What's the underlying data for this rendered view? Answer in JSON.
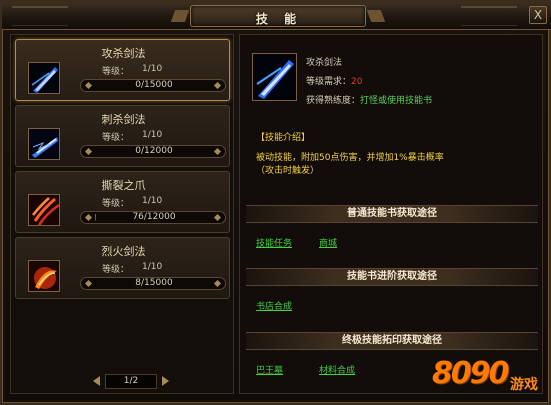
{
  "window": {
    "title": "技 能",
    "close_label": "X"
  },
  "skills": [
    {
      "name": "攻杀剑法",
      "level_label": "等级：",
      "level": "1/10",
      "exp": "0/15000",
      "exp_fraction": 0.0,
      "selected": true
    },
    {
      "name": "刺杀剑法",
      "level_label": "等级：",
      "level": "1/10",
      "exp": "0/12000",
      "exp_fraction": 0.0,
      "selected": false
    },
    {
      "name": "撕裂之爪",
      "level_label": "等级：",
      "level": "1/10",
      "exp": "76/12000",
      "exp_fraction": 0.006,
      "selected": false
    },
    {
      "name": "烈火剑法",
      "level_label": "等级：",
      "level": "1/10",
      "exp": "8/15000",
      "exp_fraction": 0.0005,
      "selected": false
    }
  ],
  "pager": {
    "text": "1/2"
  },
  "detail": {
    "name": "攻杀剑法",
    "level_req_label": "等级需求：",
    "level_req_value": "20",
    "proficiency_label": "获得熟练度：",
    "proficiency_value": "打怪或使用技能书",
    "intro_heading": "【技能介绍】",
    "intro_text": "被动技能，附加50点伤害，并增加1%暴击概率（攻击时触发）"
  },
  "sections": {
    "normal": {
      "title": "普通技能书获取途径",
      "links": [
        "技能任务",
        "商城"
      ]
    },
    "advanced": {
      "title": "技能书进阶获取途径",
      "links": [
        "书店合成"
      ]
    },
    "ultimate": {
      "title": "终极技能拓印获取途径",
      "links": [
        "巴王墓",
        "材料合成"
      ]
    }
  },
  "watermark": {
    "text": "8090",
    "text_cn": "游戏"
  },
  "colors": {
    "accent_gold": "#b28a4e",
    "link_green": "#40d040",
    "intro_yellow": "#f3d13a",
    "req_red": "#e23b2b"
  }
}
